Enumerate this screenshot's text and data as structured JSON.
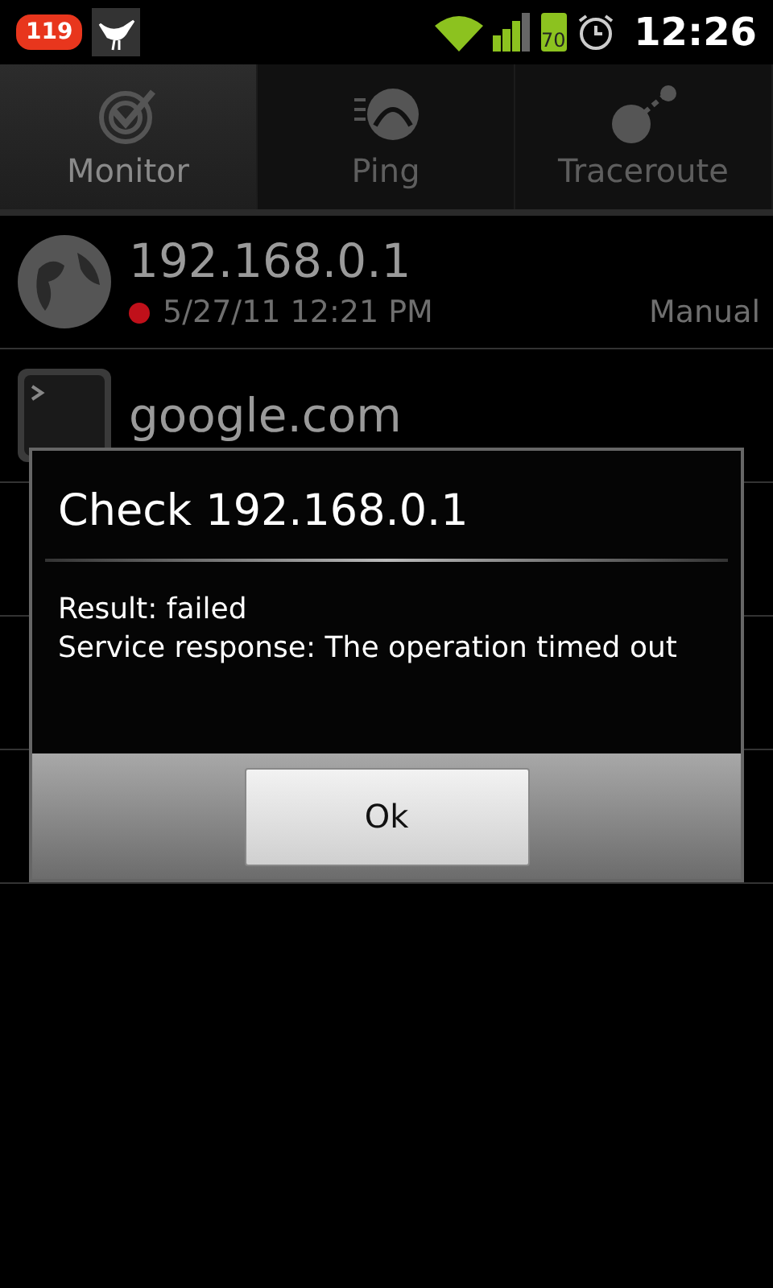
{
  "status_bar": {
    "notification_count": "119",
    "battery": "70",
    "time": "12:26"
  },
  "tabs": [
    {
      "label": "Monitor",
      "selected": true
    },
    {
      "label": "Ping",
      "selected": false
    },
    {
      "label": "Traceroute",
      "selected": false
    }
  ],
  "hosts": [
    {
      "name": "192.168.0.1",
      "color": "#c0101a",
      "time": "5/27/11 12:21 PM",
      "mode": "Manual"
    },
    {
      "name": "google.com"
    }
  ],
  "dialog": {
    "title": "Check 192.168.0.1",
    "lines": [
      "Result: failed",
      "Service response: The operation timed out"
    ],
    "button": "Ok"
  }
}
